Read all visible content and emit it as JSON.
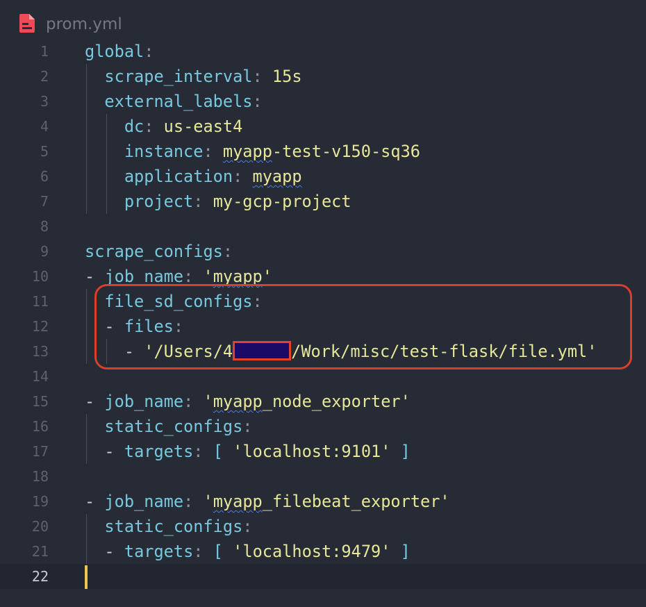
{
  "tab": {
    "filename": "prom.yml",
    "icon": "yaml-file-icon",
    "icon_color": "#ee4b57"
  },
  "editor": {
    "current_line": 22,
    "annotation_color": "#dc3e2b",
    "redaction_color": "#1b0a66"
  },
  "code": {
    "line_numbers": [
      "1",
      "2",
      "3",
      "4",
      "5",
      "6",
      "7",
      "8",
      "9",
      "10",
      "11",
      "12",
      "13",
      "14",
      "15",
      "16",
      "17",
      "18",
      "19",
      "20",
      "21",
      "22"
    ],
    "l1": {
      "key": "global"
    },
    "l2": {
      "key": "scrape_interval",
      "value": "15s"
    },
    "l3": {
      "key": "external_labels"
    },
    "l4": {
      "key": "dc",
      "value": "us-east4"
    },
    "l5": {
      "key": "instance",
      "value_a": "myapp",
      "value_b": "-test-v150-sq36"
    },
    "l6": {
      "key": "application",
      "value": "myapp"
    },
    "l7": {
      "key": "project",
      "value": "my-gcp-project"
    },
    "l9": {
      "key": "scrape_configs"
    },
    "l10": {
      "dash": "-",
      "key": "job_name",
      "q1": "'",
      "value": "myapp",
      "q2": "'"
    },
    "l11": {
      "key": "file_sd_configs"
    },
    "l12": {
      "dash": "-",
      "key": "files"
    },
    "l13": {
      "dash": "-",
      "value_a": "'/Users/4",
      "value_b": "/Work/misc/test-flask/file.yml'"
    },
    "l15": {
      "dash": "-",
      "key": "job_name",
      "q1": "'",
      "value_a": "myapp",
      "value_b": "_node_exporter'"
    },
    "l16": {
      "key": "static_configs"
    },
    "l17": {
      "dash": "-",
      "key": "targets",
      "open": "[",
      "value": "'localhost:9101'",
      "close": "]"
    },
    "l19": {
      "dash": "-",
      "key": "job_name",
      "q1": "'",
      "value_a": "myapp",
      "value_b": "_filebeat_exporter'"
    },
    "l20": {
      "key": "static_configs"
    },
    "l21": {
      "dash": "-",
      "key": "targets",
      "open": "[",
      "value": "'localhost:9479'",
      "close": "]"
    }
  }
}
